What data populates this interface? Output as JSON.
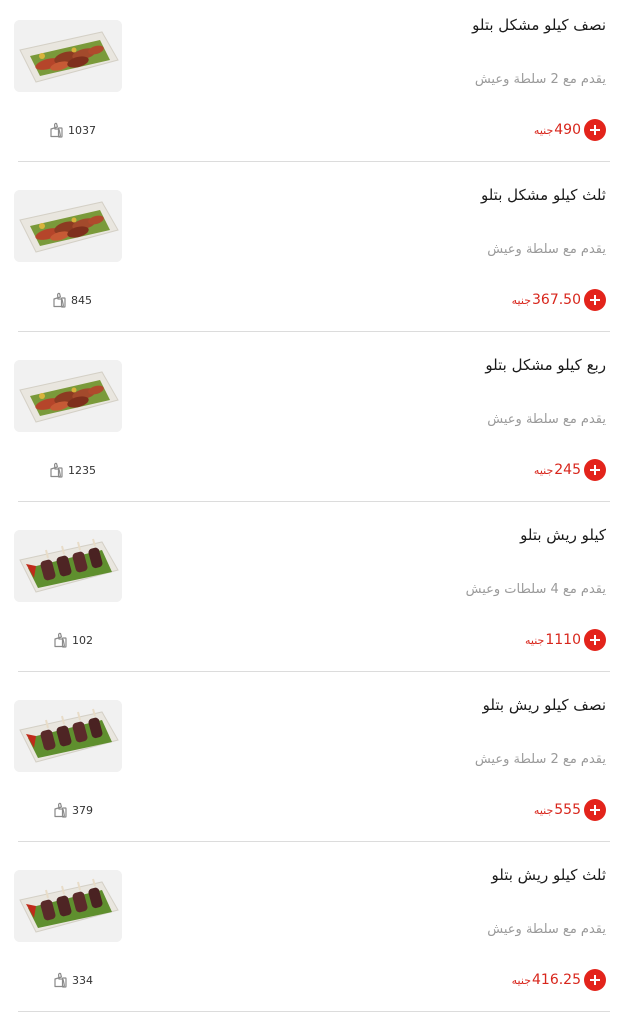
{
  "colors": {
    "accent": "#e3241b",
    "price": "#d8261c",
    "muted": "#9a9a9a",
    "divider": "#dcdcdc"
  },
  "icons": {
    "add": "plus-circle-icon",
    "like": "thumbs-up-icon"
  },
  "items": [
    {
      "title": "نصف كيلو مشكل بتلو",
      "description": "يقدم مع 2 سلطة وعيش",
      "price": "490",
      "currency": "جنيه",
      "likes": "1037",
      "image": "mixed-grill"
    },
    {
      "title": "ثلث كيلو مشكل بتلو",
      "description": "يقدم مع سلطة وعيش",
      "price": "367.50",
      "currency": "جنيه",
      "likes": "845",
      "image": "mixed-grill"
    },
    {
      "title": "ربع كيلو مشكل بتلو",
      "description": "يقدم مع سلطة وعيش",
      "price": "245",
      "currency": "جنيه",
      "likes": "1235",
      "image": "mixed-grill"
    },
    {
      "title": "كيلو ريش بتلو",
      "description": "يقدم مع 4 سلطات وعيش",
      "price": "1110",
      "currency": "جنيه",
      "likes": "102",
      "image": "ribs"
    },
    {
      "title": "نصف كيلو ريش بتلو",
      "description": "يقدم مع 2 سلطة وعيش",
      "price": "555",
      "currency": "جنيه",
      "likes": "379",
      "image": "ribs"
    },
    {
      "title": "ثلث كيلو ريش بتلو",
      "description": "يقدم مع سلطة وعيش",
      "price": "416.25",
      "currency": "جنيه",
      "likes": "334",
      "image": "ribs"
    }
  ]
}
